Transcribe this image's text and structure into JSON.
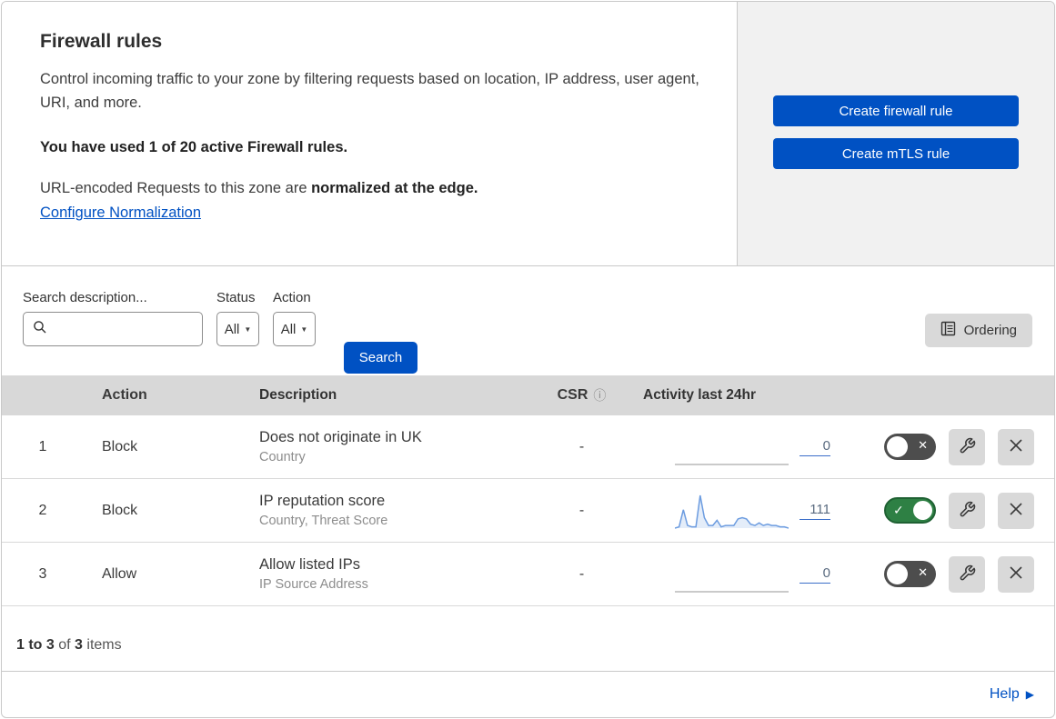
{
  "header": {
    "title": "Firewall rules",
    "description": "Control incoming traffic to your zone by filtering requests based on location, IP address, user agent, URI, and more.",
    "usage": "You have used 1 of 20 active Firewall rules.",
    "norm_prefix": "URL-encoded Requests to this zone are ",
    "norm_bold": "normalized at the edge.",
    "norm_link": "Configure Normalization",
    "create_firewall_button": "Create firewall rule",
    "create_mtls_button": "Create mTLS rule"
  },
  "filters": {
    "search_label": "Search description...",
    "search_value": "",
    "status_label": "Status",
    "status_value": "All",
    "action_label": "Action",
    "action_value": "All",
    "search_button": "Search",
    "ordering_button": "Ordering"
  },
  "table": {
    "columns": {
      "action": "Action",
      "description": "Description",
      "csr": "CSR",
      "activity": "Activity last 24hr"
    },
    "rows": [
      {
        "index": "1",
        "action": "Block",
        "title": "Does not originate in UK",
        "subtitle": "Country",
        "csr": "-",
        "count": "0",
        "enabled": false
      },
      {
        "index": "2",
        "action": "Block",
        "title": "IP reputation score",
        "subtitle": "Country, Threat Score",
        "csr": "-",
        "count": "111",
        "enabled": true
      },
      {
        "index": "3",
        "action": "Allow",
        "title": "Allow listed IPs",
        "subtitle": "IP Source Address",
        "csr": "-",
        "count": "0",
        "enabled": false
      }
    ]
  },
  "footer": {
    "range": "1 to 3",
    "of": " of ",
    "total": "3",
    "items": " items",
    "help": "Help"
  },
  "icons": {
    "search": "magnifier",
    "caret_down": "▼",
    "ordering": "list-document",
    "info": "ⓘ",
    "check": "✓",
    "cross": "✕",
    "wrench": "wrench",
    "delete": "x-cross",
    "help_arrow": "▶"
  },
  "colors": {
    "primary_blue": "#0051c3",
    "panel_gray": "#f1f1f1",
    "table_header_gray": "#d8d8d8",
    "toggle_on_green": "#2e8044",
    "toggle_off_gray": "#4d4d4d",
    "sparkline_blue": "#6c9ce0",
    "flat_line_gray": "#b9b9b9"
  },
  "chart_data": [
    {
      "type": "area",
      "title": "Activity last 24hr — rule 1",
      "total": 0,
      "values": [
        0,
        0,
        0,
        0,
        0,
        0,
        0,
        0,
        0,
        0,
        0,
        0,
        0,
        0,
        0,
        0,
        0,
        0,
        0,
        0,
        0,
        0,
        0,
        0,
        0,
        0,
        0,
        0
      ]
    },
    {
      "type": "area",
      "title": "Activity last 24hr — rule 2",
      "total": 111,
      "values": [
        0,
        1,
        14,
        2,
        1,
        1,
        25,
        8,
        2,
        2,
        6,
        1,
        2,
        2,
        2,
        7,
        8,
        7,
        3,
        2,
        4,
        2,
        3,
        2,
        2,
        1,
        1,
        0
      ]
    },
    {
      "type": "area",
      "title": "Activity last 24hr — rule 3",
      "total": 0,
      "values": [
        0,
        0,
        0,
        0,
        0,
        0,
        0,
        0,
        0,
        0,
        0,
        0,
        0,
        0,
        0,
        0,
        0,
        0,
        0,
        0,
        0,
        0,
        0,
        0,
        0,
        0,
        0,
        0
      ]
    }
  ]
}
